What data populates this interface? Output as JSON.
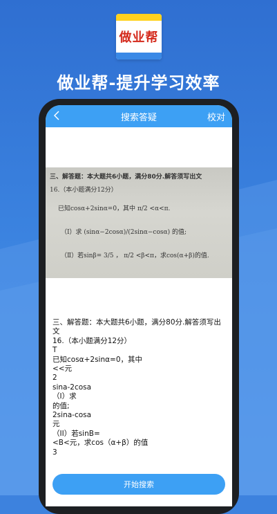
{
  "logo": {
    "text": "做业帮"
  },
  "headline": "做业帮-提升学习效率",
  "navbar": {
    "title": "搜索答疑",
    "right": "校对"
  },
  "photo": {
    "lines": [
      "三、解答题：本大题共6小题，满分80分.解答须写出文",
      "16.（本小题满分12分）",
      "已知cosα+2sinα=0，其中 π/2 <α<π.",
      "（Ⅰ）求 (sinα−2cosα)/(2sinα−cosα) 的值;",
      "（Ⅱ）若sinβ= 3/5 ， π/2 <β<π，求cos(α+β)的值."
    ]
  },
  "result": {
    "lines": [
      "三、解答题：本大题共6小题，满分80分.解答须写出",
      "文",
      "16.（本小题满分12分）",
      "T",
      "已知cosα+2sinα=0，其中",
      "<<元",
      "2",
      "sina-2cosa",
      "（I）求",
      "的值;",
      "2sina-cosa",
      "元",
      "（II）若sinB=",
      "<B<元，求cos（α+β）的值",
      "3"
    ]
  },
  "button": {
    "label": "开始搜索"
  },
  "colors": {
    "accent": "#3da0f4",
    "background": "#3d82de",
    "logo_red": "#d42a1c",
    "logo_yellow": "#ffd21f"
  },
  "icons": {
    "back": "chevron-left-icon"
  }
}
